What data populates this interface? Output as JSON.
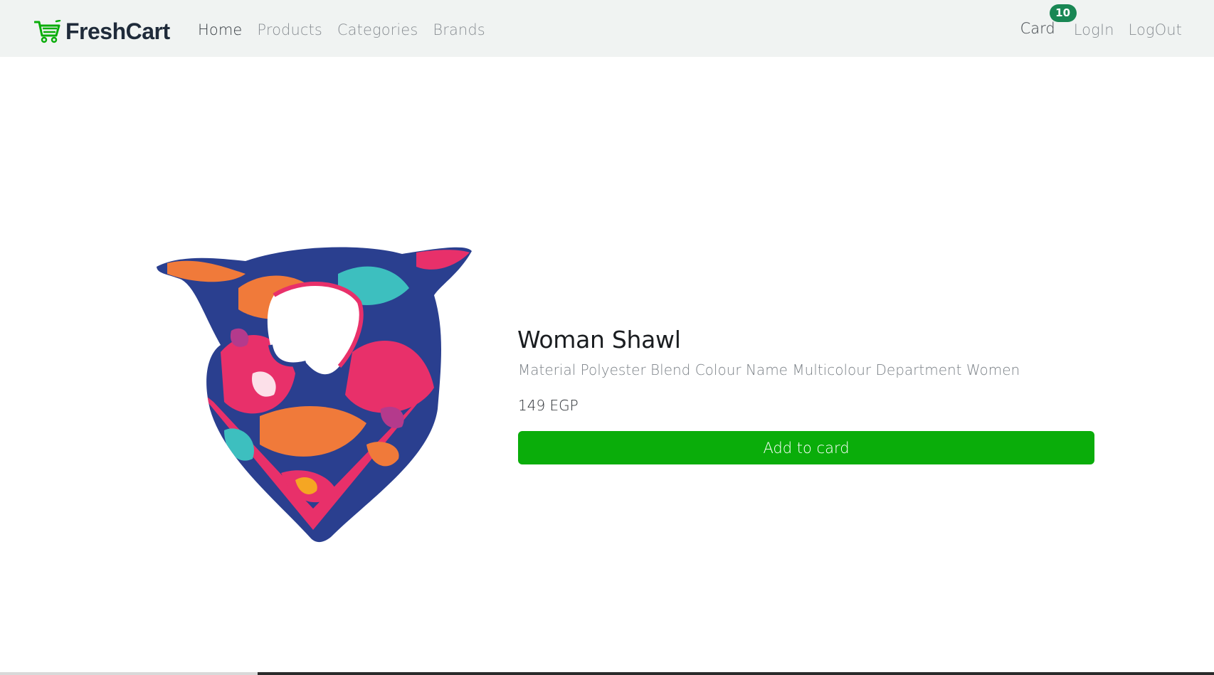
{
  "brand": {
    "name": "FreshCart",
    "icon": "cart-icon",
    "color": "#0aad0a"
  },
  "nav": {
    "links": [
      "Home",
      "Products",
      "Categories",
      "Brands"
    ],
    "cart_label": "Card",
    "cart_count": "10",
    "login_label": "LogIn",
    "logout_label": "LogOut"
  },
  "product": {
    "image": "woman-shawl-image",
    "title": "Woman Shawl",
    "description": "Material Polyester Blend Colour Name Multicolour Department Women",
    "price": "149 EGP",
    "add_button_label": "Add to card"
  },
  "colors": {
    "navbar_bg": "#f0f3f2",
    "button_bg": "#0aad0a",
    "badge_bg": "#198754"
  }
}
